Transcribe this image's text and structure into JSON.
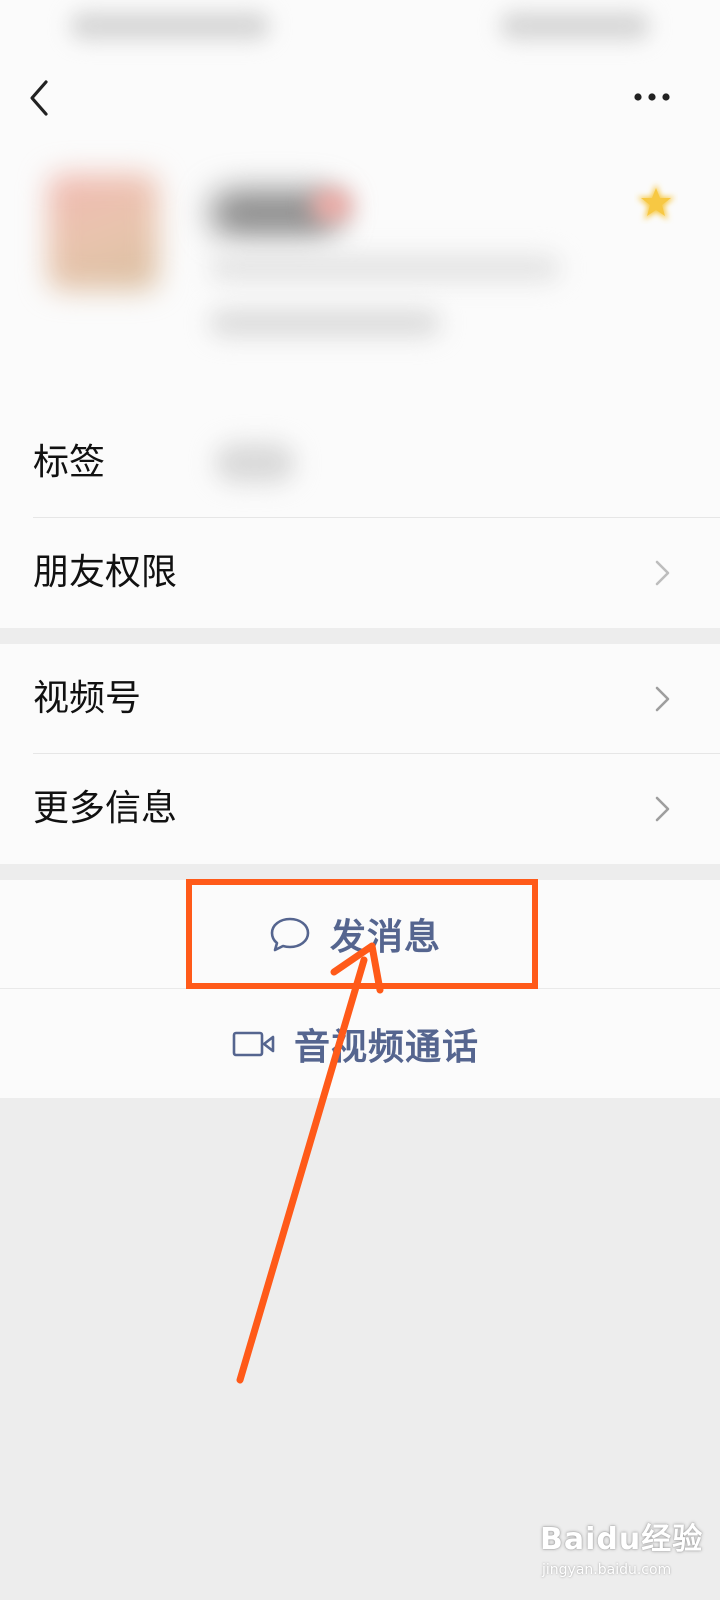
{
  "nav": {
    "back_icon": "chevron-left-icon",
    "more_icon": "more-dots-icon"
  },
  "profile": {
    "star_icon": "star-icon",
    "star_color": "#f7c843"
  },
  "rows": [
    {
      "label": "标签"
    },
    {
      "label": "朋友权限"
    },
    {
      "label": "视频号"
    },
    {
      "label": "更多信息"
    }
  ],
  "actions": {
    "send_message": {
      "label": "发消息",
      "icon": "chat-bubble-icon"
    },
    "video_call": {
      "label": "音视频通话",
      "icon": "video-camera-icon"
    }
  },
  "annotation": {
    "color": "#ff5a19"
  },
  "watermark": {
    "main": "Baidu经验",
    "sub": "jingyan.baidu.com"
  },
  "colors": {
    "link": "#55658f",
    "background": "#ededed",
    "panel": "#fbfbfb"
  }
}
